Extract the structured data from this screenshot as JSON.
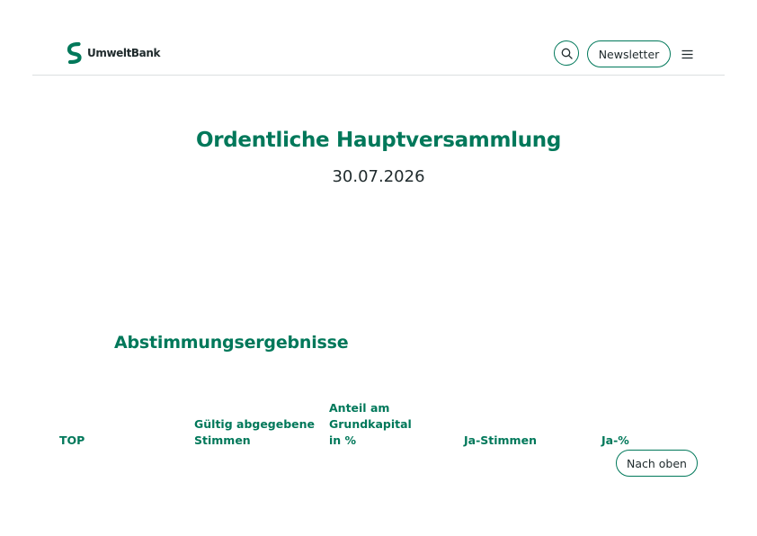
{
  "header": {
    "logo_text": "UmweltBank",
    "newsletter_label": "Newsletter"
  },
  "main": {
    "title": "Ordentliche Hauptversammlung",
    "date": "30.07.2026",
    "section_title": "Abstimmungsergebnisse",
    "table": {
      "columns": [
        {
          "line1": "TOP",
          "line2": "",
          "line3": ""
        },
        {
          "line1": "Gültig abgegebene",
          "line2": "Stimmen",
          "line3": ""
        },
        {
          "line1": "Anteil am",
          "line2": "Grundkapital",
          "line3": "in %"
        },
        {
          "line1": "Ja-Stimmen",
          "line2": "",
          "line3": ""
        },
        {
          "line1": "Ja-%",
          "line2": "",
          "line3": ""
        }
      ]
    },
    "back_to_top_label": "Nach oben"
  },
  "colors": {
    "brand_green": "#00785a",
    "text_dark": "#1f2a2c",
    "divider": "#dcdfe0"
  },
  "icons": {
    "logo": "umweltbank-logo-icon",
    "search": "search-icon",
    "menu": "hamburger-menu-icon"
  }
}
